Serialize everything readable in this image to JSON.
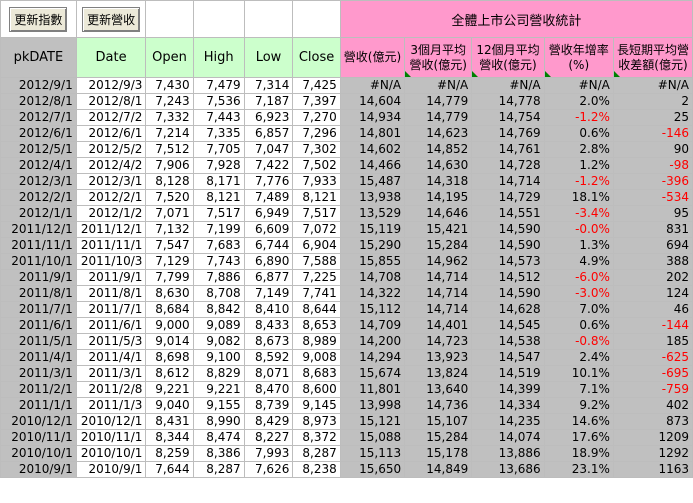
{
  "buttons": {
    "update_index": "更新指數",
    "update_revenue": "更新營收"
  },
  "title": "全體上市公司營收統計",
  "headers": {
    "pkdate": "pkDATE",
    "date": "Date",
    "open": "Open",
    "high": "High",
    "low": "Low",
    "close": "Close",
    "revenue": "營收(億元)",
    "avg3_line1": "3個月平均",
    "avg3_line2": "營收(億元)",
    "avg12_line1": "12個月平均",
    "avg12_line2": "營收(億元)",
    "yoy_line1": "營收年增率",
    "yoy_line2": "(%)",
    "diff_line1": "長短期平均營",
    "diff_line2": "收差額(億元)"
  },
  "colors": {
    "pink": "#ff99cc",
    "green": "#ccffcc",
    "grey": "#c0c0c0",
    "negative": "#ff0000"
  },
  "rows": [
    [
      "2012/9/1",
      "2012/9/3",
      "7,430",
      "7,479",
      "7,314",
      "7,425",
      "#N/A",
      "#N/A",
      "#N/A",
      "#N/A",
      "#N/A"
    ],
    [
      "2012/8/1",
      "2012/8/1",
      "7,243",
      "7,536",
      "7,187",
      "7,397",
      "14,604",
      "14,779",
      "14,778",
      "2.0%",
      "2"
    ],
    [
      "2012/7/1",
      "2012/7/2",
      "7,332",
      "7,443",
      "6,923",
      "7,270",
      "14,934",
      "14,779",
      "14,754",
      "-1.2%",
      "25"
    ],
    [
      "2012/6/1",
      "2012/6/1",
      "7,214",
      "7,335",
      "6,857",
      "7,296",
      "14,801",
      "14,623",
      "14,769",
      "0.6%",
      "-146"
    ],
    [
      "2012/5/1",
      "2012/5/2",
      "7,512",
      "7,705",
      "7,047",
      "7,302",
      "14,602",
      "14,852",
      "14,761",
      "2.8%",
      "90"
    ],
    [
      "2012/4/1",
      "2012/4/2",
      "7,906",
      "7,928",
      "7,422",
      "7,502",
      "14,466",
      "14,630",
      "14,728",
      "1.2%",
      "-98"
    ],
    [
      "2012/3/1",
      "2012/3/1",
      "8,128",
      "8,171",
      "7,776",
      "7,933",
      "15,487",
      "14,318",
      "14,714",
      "-1.2%",
      "-396"
    ],
    [
      "2012/2/1",
      "2012/2/1",
      "7,520",
      "8,121",
      "7,489",
      "8,121",
      "13,938",
      "14,195",
      "14,729",
      "18.1%",
      "-534"
    ],
    [
      "2012/1/1",
      "2012/1/2",
      "7,071",
      "7,517",
      "6,949",
      "7,517",
      "13,529",
      "14,646",
      "14,551",
      "-3.4%",
      "95"
    ],
    [
      "2011/12/1",
      "2011/12/1",
      "7,132",
      "7,199",
      "6,609",
      "7,072",
      "15,119",
      "15,421",
      "14,590",
      "-0.0%",
      "831"
    ],
    [
      "2011/11/1",
      "2011/11/1",
      "7,547",
      "7,683",
      "6,744",
      "6,904",
      "15,290",
      "15,284",
      "14,590",
      "1.3%",
      "694"
    ],
    [
      "2011/10/1",
      "2011/10/3",
      "7,129",
      "7,743",
      "6,890",
      "7,588",
      "15,855",
      "14,962",
      "14,573",
      "4.9%",
      "388"
    ],
    [
      "2011/9/1",
      "2011/9/1",
      "7,799",
      "7,886",
      "6,877",
      "7,225",
      "14,708",
      "14,714",
      "14,512",
      "-6.0%",
      "202"
    ],
    [
      "2011/8/1",
      "2011/8/1",
      "8,630",
      "8,708",
      "7,149",
      "7,741",
      "14,322",
      "14,714",
      "14,590",
      "-3.0%",
      "124"
    ],
    [
      "2011/7/1",
      "2011/7/1",
      "8,684",
      "8,842",
      "8,410",
      "8,644",
      "15,112",
      "14,714",
      "14,628",
      "7.0%",
      "46"
    ],
    [
      "2011/6/1",
      "2011/6/1",
      "9,000",
      "9,089",
      "8,433",
      "8,653",
      "14,709",
      "14,401",
      "14,545",
      "0.6%",
      "-144"
    ],
    [
      "2011/5/1",
      "2011/5/3",
      "9,014",
      "9,082",
      "8,673",
      "8,989",
      "14,200",
      "14,723",
      "14,538",
      "-0.8%",
      "185"
    ],
    [
      "2011/4/1",
      "2011/4/1",
      "8,698",
      "9,100",
      "8,592",
      "9,008",
      "14,294",
      "13,923",
      "14,547",
      "2.4%",
      "-625"
    ],
    [
      "2011/3/1",
      "2011/3/1",
      "8,612",
      "8,829",
      "8,071",
      "8,683",
      "15,674",
      "13,824",
      "14,519",
      "10.1%",
      "-695"
    ],
    [
      "2011/2/1",
      "2011/2/8",
      "9,221",
      "9,221",
      "8,470",
      "8,600",
      "11,801",
      "13,640",
      "14,399",
      "7.1%",
      "-759"
    ],
    [
      "2011/1/1",
      "2011/1/3",
      "9,040",
      "9,155",
      "8,739",
      "9,145",
      "13,998",
      "14,736",
      "14,334",
      "9.2%",
      "402"
    ],
    [
      "2010/12/1",
      "2010/12/1",
      "8,431",
      "8,990",
      "8,429",
      "8,973",
      "15,121",
      "15,107",
      "14,235",
      "14.6%",
      "873"
    ],
    [
      "2010/11/1",
      "2010/11/1",
      "8,344",
      "8,474",
      "8,227",
      "8,372",
      "15,088",
      "15,284",
      "14,074",
      "17.6%",
      "1209"
    ],
    [
      "2010/10/1",
      "2010/10/1",
      "8,259",
      "8,386",
      "7,993",
      "8,287",
      "15,113",
      "15,178",
      "13,886",
      "18.9%",
      "1292"
    ],
    [
      "2010/9/1",
      "2010/9/1",
      "7,644",
      "8,287",
      "7,626",
      "8,238",
      "15,650",
      "14,849",
      "13,686",
      "23.1%",
      "1163"
    ]
  ]
}
